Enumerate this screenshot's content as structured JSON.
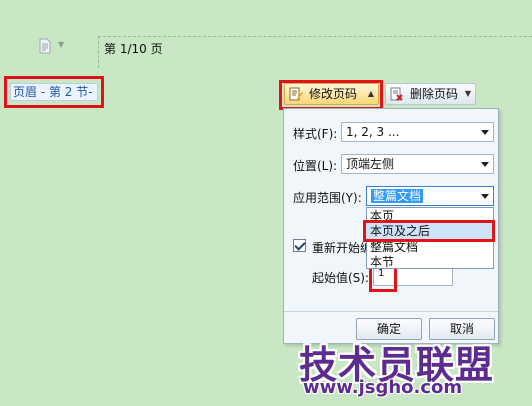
{
  "document": {
    "page_indicator": "第 1/10 页"
  },
  "header_tag": {
    "label": "页眉 - 第 2 节-"
  },
  "toolbar": {
    "modify_label": "修改页码",
    "delete_label": "删除页码"
  },
  "panel": {
    "style_label": "样式(F):",
    "style_value": "1, 2, 3 ...",
    "position_label": "位置(L):",
    "position_value": "顶端左侧",
    "range_label": "应用范围(Y):",
    "range_value": "整篇文档",
    "range_options": [
      "本页",
      "本页及之后",
      "整篇文档",
      "本节"
    ],
    "restart_label": "重新开始编",
    "restart_checked": true,
    "start_label": "起始值(S):",
    "start_value": "1",
    "ok_label": "确定",
    "cancel_label": "取消"
  },
  "watermark": {
    "text": "技术员联盟",
    "url": "www.jsgho.com"
  },
  "colors": {
    "background": "#c9e7c5",
    "highlight": "#e01418",
    "watermark": "#5c2c8f"
  }
}
